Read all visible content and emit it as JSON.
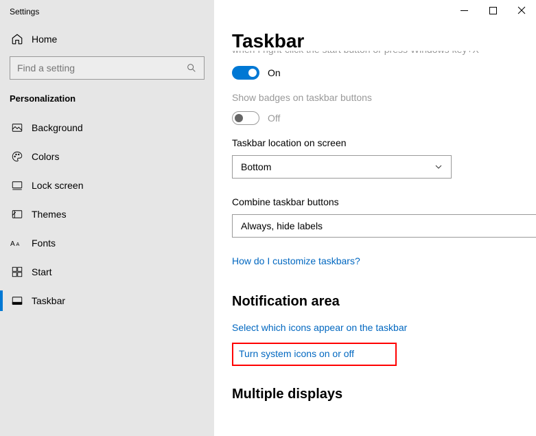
{
  "window": {
    "title": "Settings"
  },
  "sidebar": {
    "home_label": "Home",
    "search_placeholder": "Find a setting",
    "section_title": "Personalization",
    "items": [
      {
        "label": "Background"
      },
      {
        "label": "Colors"
      },
      {
        "label": "Lock screen"
      },
      {
        "label": "Themes"
      },
      {
        "label": "Fonts"
      },
      {
        "label": "Start"
      },
      {
        "label": "Taskbar"
      }
    ]
  },
  "main": {
    "title": "Taskbar",
    "cut_off_text": "when I right-click the start button or press Windows key+X",
    "toggle1_label": "On",
    "badges_label": "Show badges on taskbar buttons",
    "toggle2_label": "Off",
    "location_label": "Taskbar location on screen",
    "location_value": "Bottom",
    "combine_label": "Combine taskbar buttons",
    "combine_value": "Always, hide labels",
    "customize_link": "How do I customize taskbars?",
    "notification_header": "Notification area",
    "select_icons_link": "Select which icons appear on the taskbar",
    "system_icons_link": "Turn system icons on or off",
    "multiple_header": "Multiple displays"
  }
}
